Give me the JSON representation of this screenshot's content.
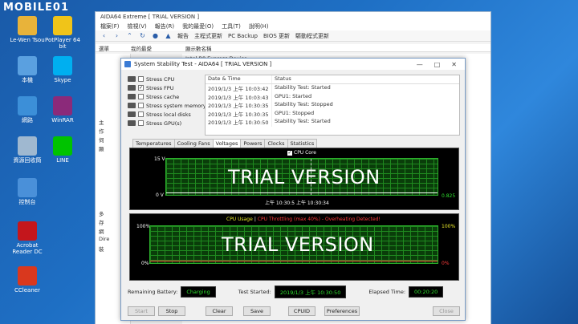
{
  "watermark": {
    "text": "MOBILE01"
  },
  "desktop": {
    "icons": [
      {
        "label": "Le-Wen Tsou",
        "icon": "user-folder-icon",
        "color": "#e8b33a"
      },
      {
        "label": "PotPlayer 64 bit",
        "icon": "potplayer-icon",
        "color": "#f0c419"
      },
      {
        "label": "本機",
        "icon": "computer-icon",
        "color": "#5aa0e0"
      },
      {
        "label": "Skype",
        "icon": "skype-icon",
        "color": "#00aff0"
      },
      {
        "label": "網路",
        "icon": "network-icon",
        "color": "#3c8fd8"
      },
      {
        "label": "WinRAR",
        "icon": "winrar-icon",
        "color": "#8b2a7a"
      },
      {
        "label": "資源回收筒",
        "icon": "recycle-bin-icon",
        "color": "#9fb8d0"
      },
      {
        "label": "LINE",
        "icon": "line-icon",
        "color": "#00c300"
      },
      {
        "label": "控制台",
        "icon": "control-panel-icon",
        "color": "#4a90d9"
      },
      {
        "label": "Acrobat Reader DC",
        "icon": "acrobat-icon",
        "color": "#c4161c"
      },
      {
        "label": "CCleaner",
        "icon": "ccleaner-icon",
        "color": "#d9381e"
      }
    ]
  },
  "main_window": {
    "title": "AIDA64 Extreme  [ TRIAL VERSION ]",
    "menu": [
      "檔案(F)",
      "檢視(V)",
      "報告(R)",
      "我的最愛(O)",
      "工具(T)",
      "說明(H)"
    ],
    "toolbar": [
      "報告",
      "主程式更新",
      "PC Backup",
      "BIOS 更新",
      "驅動程式更新"
    ],
    "columns": [
      "選單",
      "我的最愛",
      "顯示數名稱"
    ],
    "first_item": "Intel R8 Express Device",
    "tree_items": [
      "主",
      "作",
      "伺",
      "顯",
      "多",
      "存",
      "網",
      "Dire",
      "裝"
    ]
  },
  "dialog": {
    "title": "System Stability Test - AIDA64  [ TRIAL VERSION ]",
    "stress_items": [
      {
        "label": "Stress CPU",
        "checked": false
      },
      {
        "label": "Stress FPU",
        "checked": true
      },
      {
        "label": "Stress cache",
        "checked": false
      },
      {
        "label": "Stress system memory",
        "checked": false
      },
      {
        "label": "Stress local disks",
        "checked": false
      },
      {
        "label": "Stress GPU(s)",
        "checked": false
      }
    ],
    "log": {
      "headers": [
        "Date & Time",
        "Status"
      ],
      "rows": [
        {
          "time": "2019/1/3 上午 10:03:42",
          "status": "Stability Test: Started"
        },
        {
          "time": "2019/1/3 上午 10:03:43",
          "status": "GPU1: Started"
        },
        {
          "time": "2019/1/3 上午 10:30:35",
          "status": "Stability Test: Stopped"
        },
        {
          "time": "2019/1/3 上午 10:30:35",
          "status": "GPU1: Stopped"
        },
        {
          "time": "2019/1/3 上午 10:30:50",
          "status": "Stability Test: Started"
        }
      ]
    },
    "tabs": [
      "Temperatures",
      "Cooling Fans",
      "Voltages",
      "Powers",
      "Clocks",
      "Statistics"
    ],
    "active_tab": "Voltages",
    "graph1": {
      "legend": "CPU Core",
      "y_top": "15 V",
      "y_bottom": "0 V",
      "value": "0.825",
      "x_label": "上午 10:30:5 上午 10:30:34",
      "overlay": "TRIAL VERSION"
    },
    "graph2": {
      "legend_usage": "CPU Usage",
      "legend_sep": "|",
      "legend_throttle": "CPU Throttling (max 40%) - Overheating Detected!",
      "y_top_left": "100%",
      "y_bottom_left": "0%",
      "y_top_right": "100%",
      "y_bottom_right": "0%",
      "overlay": "TRIAL VERSION"
    },
    "status": {
      "battery_label": "Remaining Battery:",
      "battery_value": "Charging",
      "started_label": "Test Started:",
      "started_value": "2019/1/3 上午 10:30:50",
      "elapsed_label": "Elapsed Time:",
      "elapsed_value": "00:20:20"
    },
    "buttons": [
      "Start",
      "Stop",
      "Clear",
      "Save",
      "CPUID",
      "Preferences",
      "Close"
    ]
  }
}
